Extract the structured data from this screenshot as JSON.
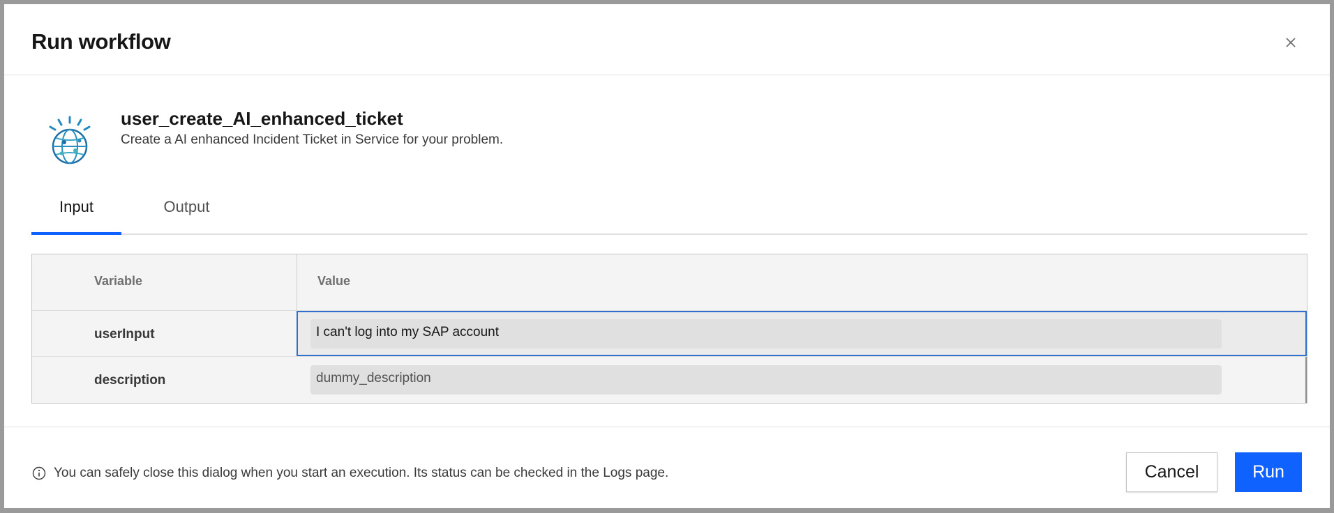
{
  "dialog": {
    "title": "Run workflow",
    "close_icon": "close-icon"
  },
  "workflow": {
    "icon": "ibm-watson-globe-icon",
    "name": "user_create_AI_enhanced_ticket",
    "description": "Create a AI enhanced Incident Ticket in Service for your problem."
  },
  "tabs": [
    {
      "label": "Input",
      "active": true
    },
    {
      "label": "Output",
      "active": false
    }
  ],
  "table": {
    "headers": {
      "variable": "Variable",
      "value": "Value"
    },
    "rows": [
      {
        "variable": "userInput",
        "value": "I can't log into my SAP account"
      },
      {
        "variable": "description",
        "value": "dummy_description"
      }
    ]
  },
  "footer": {
    "info_icon": "info-icon",
    "info_text": "You can safely close this dialog when you start an execution. Its status can be checked in the Logs page.",
    "cancel_label": "Cancel",
    "run_label": "Run"
  },
  "colors": {
    "primary": "#0f62fe",
    "focus_border": "#2f6fce"
  }
}
